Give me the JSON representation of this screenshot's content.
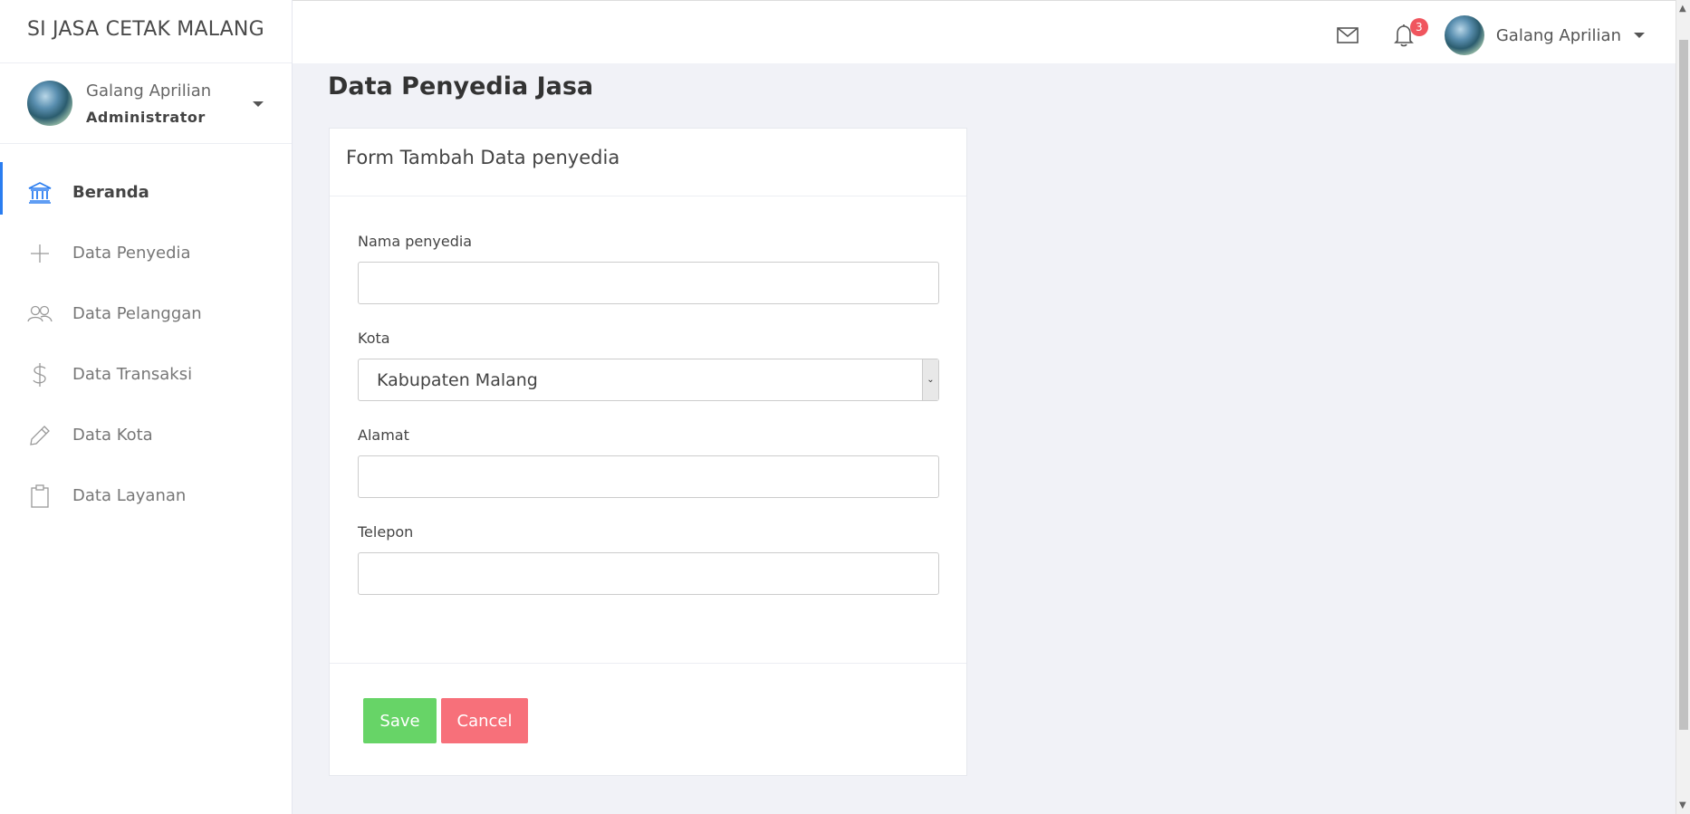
{
  "brand": "SI JASA CETAK MALANG",
  "profile": {
    "name": "Galang Aprilian",
    "role": "Administrator"
  },
  "menu": [
    {
      "label": "Beranda",
      "icon": "bank-icon",
      "active": true
    },
    {
      "label": "Data Penyedia",
      "icon": "plus-icon",
      "active": false
    },
    {
      "label": "Data Pelanggan",
      "icon": "users-icon",
      "active": false
    },
    {
      "label": "Data Transaksi",
      "icon": "dollar-icon",
      "active": false
    },
    {
      "label": "Data Kota",
      "icon": "pencil-icon",
      "active": false
    },
    {
      "label": "Data Layanan",
      "icon": "clipboard-icon",
      "active": false
    }
  ],
  "topbar": {
    "notification_count": "3",
    "user_name": "Galang Aprilian"
  },
  "page_title": "Data Penyedia Jasa",
  "form": {
    "title": "Form Tambah Data penyedia",
    "fields": {
      "nama": {
        "label": "Nama penyedia",
        "value": ""
      },
      "kota": {
        "label": "Kota",
        "value": "Kabupaten Malang"
      },
      "alamat": {
        "label": "Alamat",
        "value": ""
      },
      "telepon": {
        "label": "Telepon",
        "value": ""
      }
    },
    "save_label": "Save",
    "cancel_label": "Cancel"
  },
  "colors": {
    "accent": "#2a7df0",
    "save": "#67d467",
    "cancel": "#f7707a",
    "badge": "#f0555e",
    "background": "#f1f2f7"
  }
}
